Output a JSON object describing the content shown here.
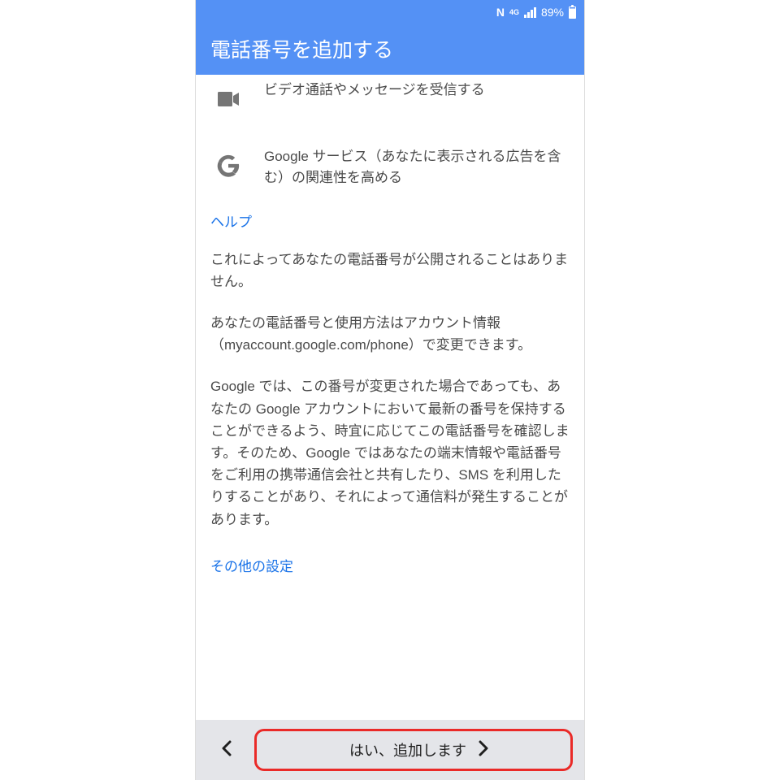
{
  "statusbar": {
    "nfc": "N",
    "network": "4G",
    "battery_pct": "89%"
  },
  "appbar": {
    "title": "電話番号を追加する"
  },
  "features": {
    "video": "ビデオ通話やメッセージを受信する",
    "google": "Google サービス（あなたに表示される広告を含む）の関連性を高める"
  },
  "links": {
    "help": "ヘルプ",
    "other_settings": "その他の設定"
  },
  "body": {
    "p1": "これによってあなたの電話番号が公開されることはありません。",
    "p2": "あなたの電話番号と使用方法はアカウント情報（myaccount.google.com/phone）で変更できます。",
    "p3": "Google では、この番号が変更された場合であっても、あなたの Google アカウントにおいて最新の番号を保持することができるよう、時宜に応じてこの電話番号を確認します。そのため、Google ではあなたの端末情報や電話番号をご利用の携帯通信会社と共有したり、SMS を利用したりすることがあり、それによって通信料が発生することがあります。"
  },
  "footer": {
    "confirm_label": "はい、追加します"
  }
}
